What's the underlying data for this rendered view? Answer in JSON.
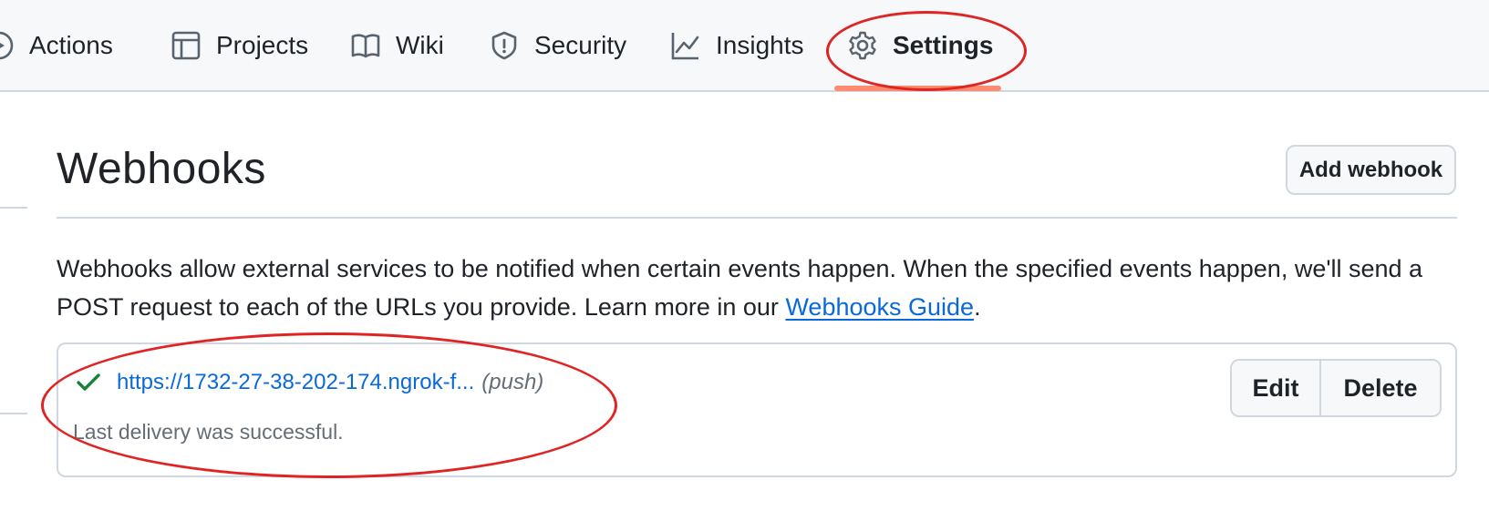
{
  "nav": {
    "items": [
      {
        "label": "Actions",
        "icon": "play-circle-icon"
      },
      {
        "label": "Projects",
        "icon": "table-icon"
      },
      {
        "label": "Wiki",
        "icon": "book-icon"
      },
      {
        "label": "Security",
        "icon": "shield-icon"
      },
      {
        "label": "Insights",
        "icon": "graph-icon"
      },
      {
        "label": "Settings",
        "icon": "gear-icon",
        "active": true
      }
    ]
  },
  "header": {
    "title": "Webhooks",
    "add_button": "Add webhook"
  },
  "description": {
    "text": "Webhooks allow external services to be notified when certain events happen. When the specified events happen, we'll send a POST request to each of the URLs you provide. Learn more in our ",
    "link": "Webhooks Guide",
    "end": "."
  },
  "webhook": {
    "url": "https://1732-27-38-202-174.ngrok-f...",
    "events": "(push)",
    "status": "Last delivery was successful.",
    "edit_label": "Edit",
    "delete_label": "Delete"
  },
  "colors": {
    "accent_link": "#0969da",
    "success": "#1a7f37",
    "annotation": "#e02424",
    "active_tab": "#fd8c73"
  }
}
